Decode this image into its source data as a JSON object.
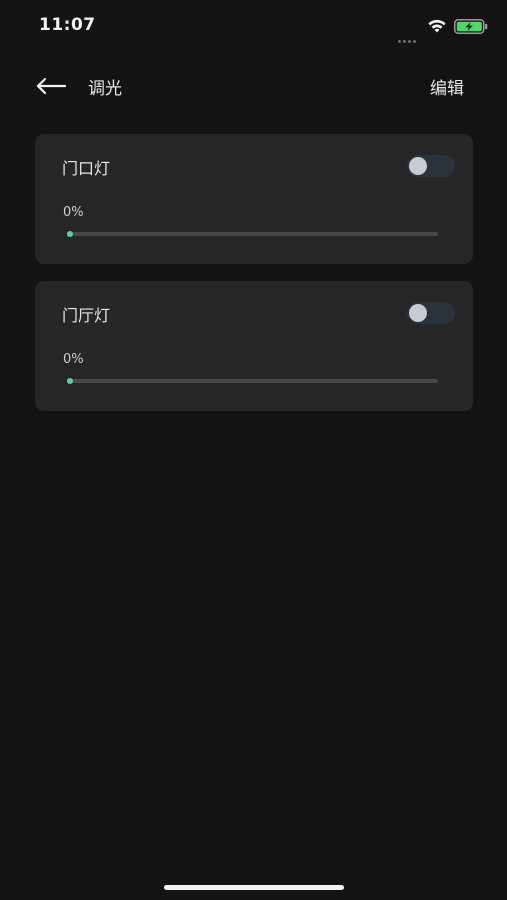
{
  "status_bar": {
    "time": "11:07",
    "icons": [
      "signal-dots-icon",
      "wifi-icon",
      "battery-charging-icon"
    ]
  },
  "nav": {
    "back_icon": "arrow-left-icon",
    "title": "调光",
    "edit_label": "编辑"
  },
  "lights": [
    {
      "name": "门口灯",
      "on": false,
      "brightness_label": "0%",
      "brightness": 0
    },
    {
      "name": "门厅灯",
      "on": false,
      "brightness_label": "0%",
      "brightness": 0
    }
  ],
  "colors": {
    "background": "#131313",
    "card": "#262626",
    "accent": "#5ad1ac",
    "toggle_off_track": "#2a323c",
    "toggle_knob": "#c7ccd4"
  }
}
